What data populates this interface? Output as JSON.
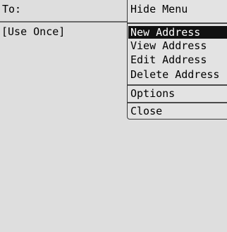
{
  "screen": {
    "to_label": "To:",
    "recipient_option": "[Use Once]"
  },
  "menu": {
    "items": [
      {
        "label": "Hide Menu"
      },
      {
        "label": "New Address",
        "selected": true
      },
      {
        "label": "View Address"
      },
      {
        "label": "Edit Address"
      },
      {
        "label": "Delete Address"
      },
      {
        "label": "Options"
      },
      {
        "label": "Close"
      }
    ]
  },
  "colors": {
    "background": "#dedede",
    "selection": "#111111",
    "text": "#000000",
    "selected_text": "#ffffff"
  }
}
